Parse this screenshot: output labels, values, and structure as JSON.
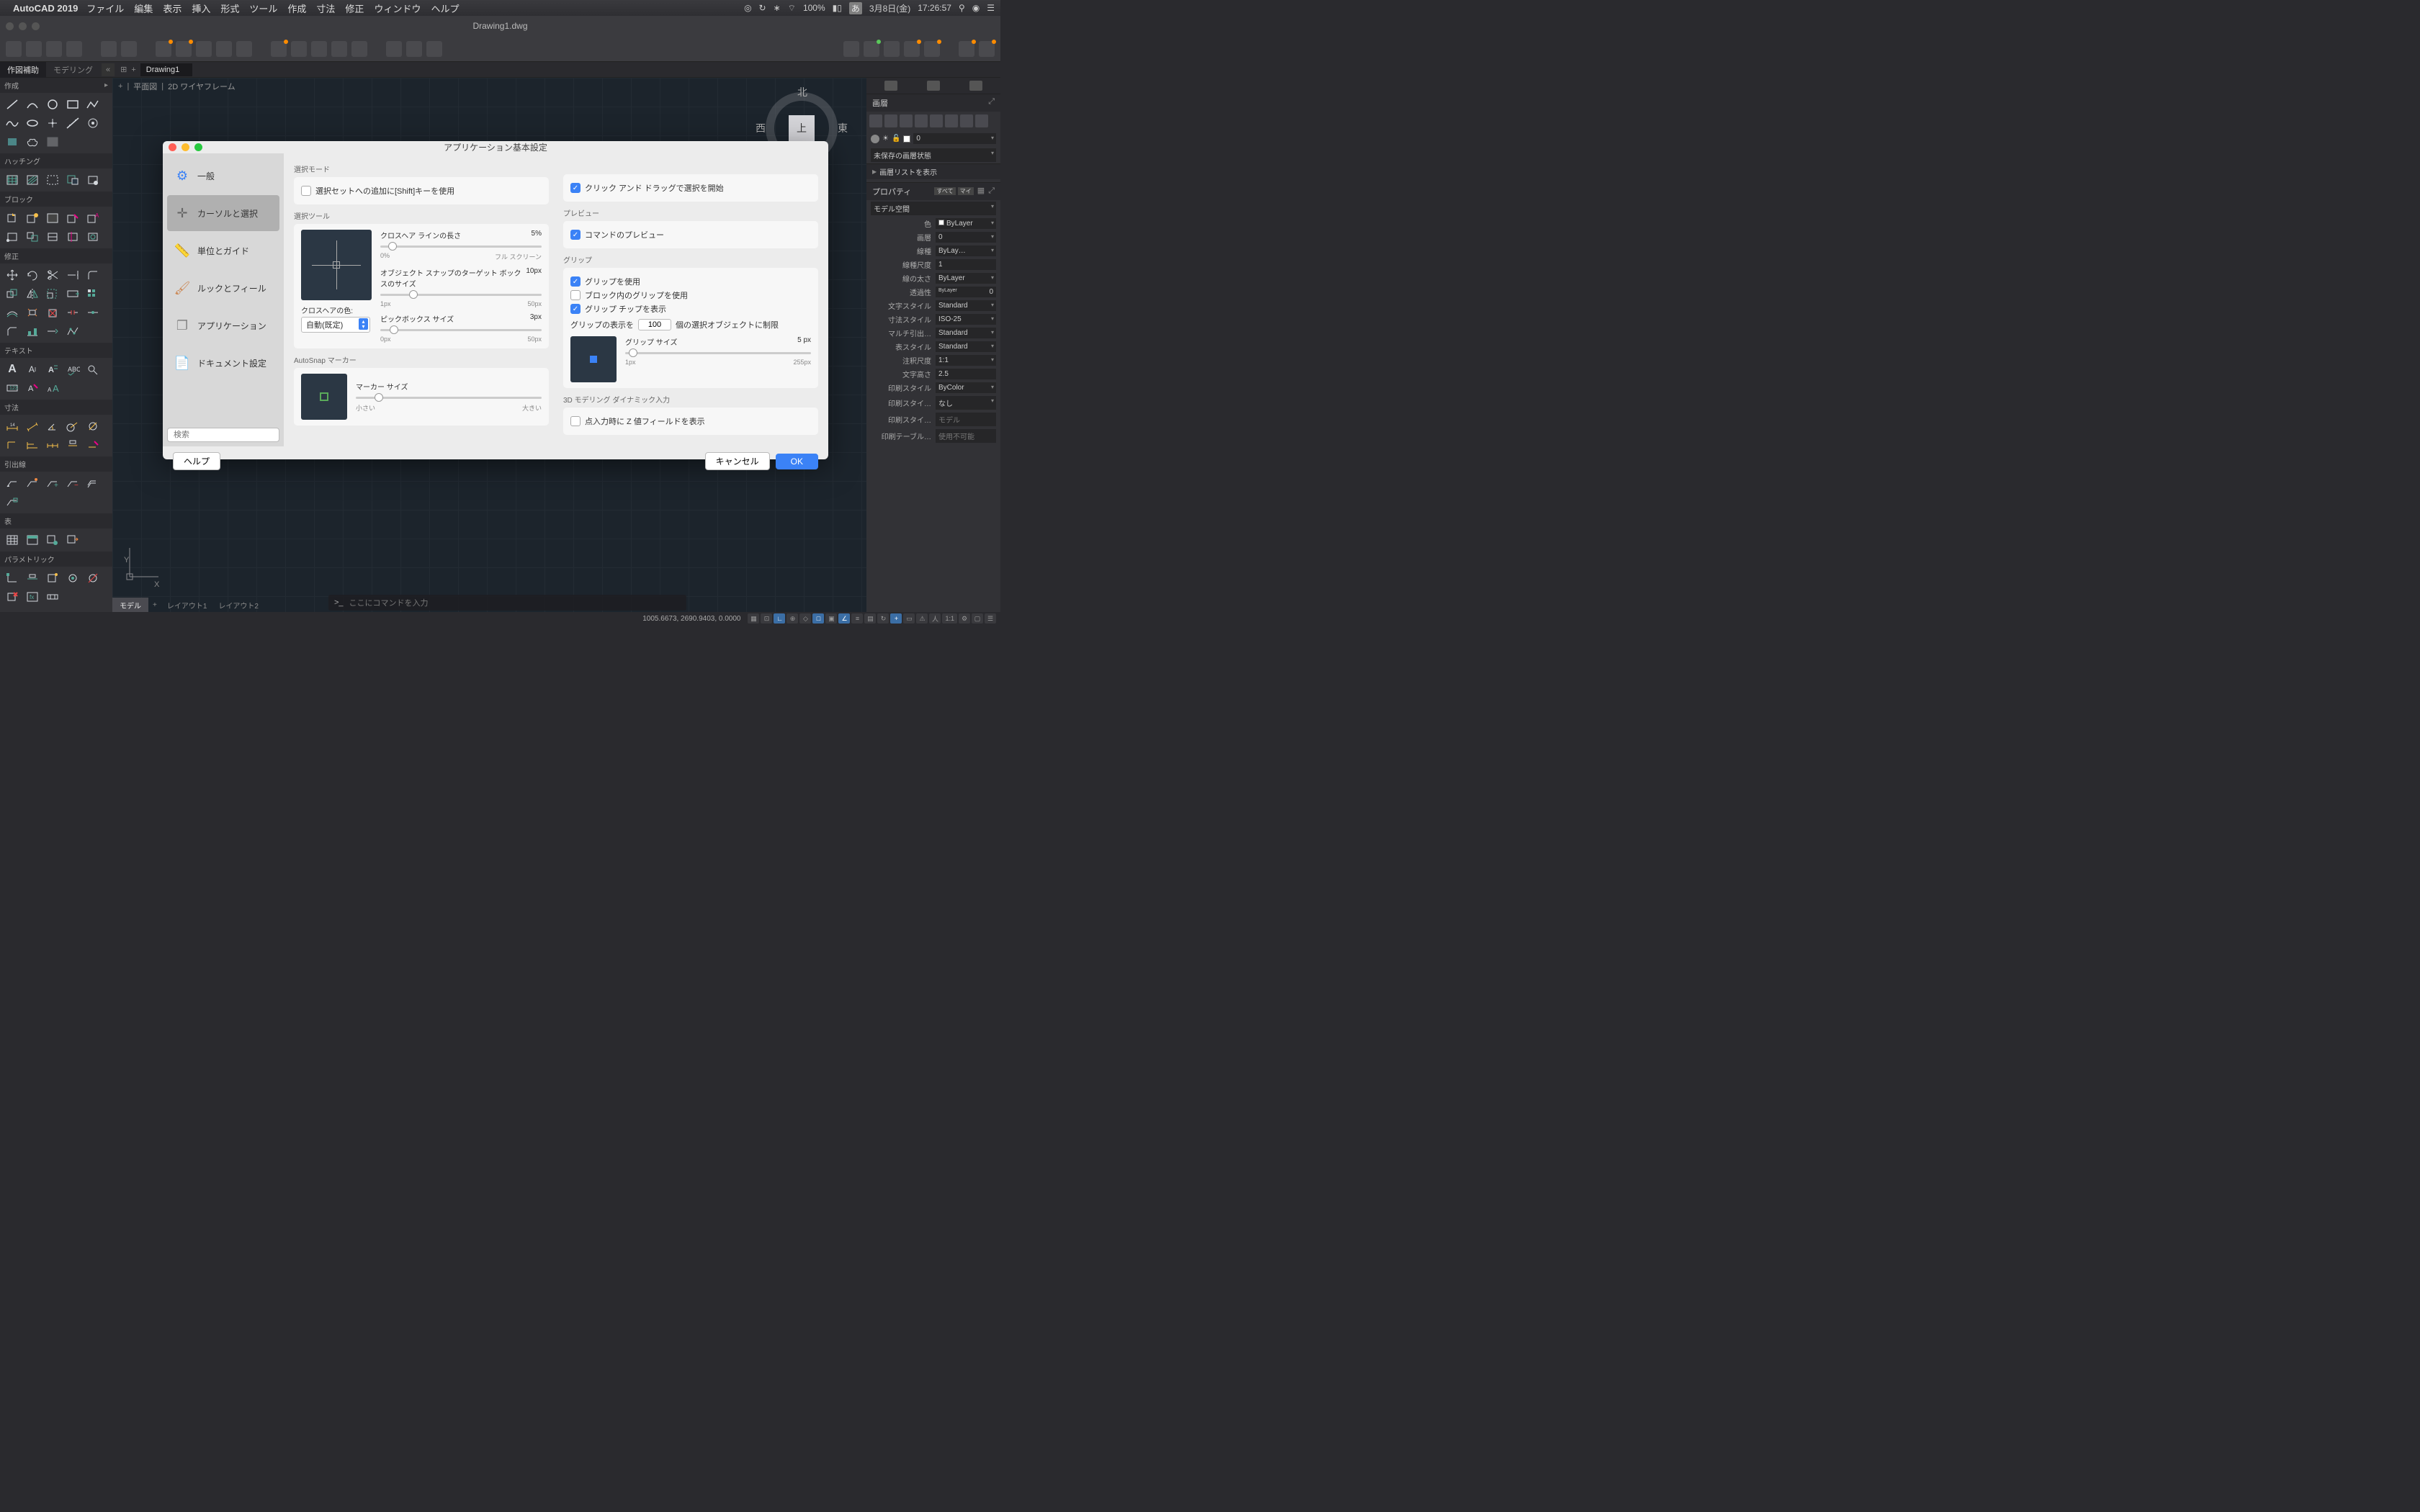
{
  "menubar": {
    "app": "AutoCAD 2019",
    "items": [
      "ファイル",
      "編集",
      "表示",
      "挿入",
      "形式",
      "ツール",
      "作成",
      "寸法",
      "修正",
      "ウィンドウ",
      "ヘルプ"
    ],
    "right": {
      "battery": "100%",
      "ime": "あ",
      "date": "3月8日(金)",
      "time": "17:26:57"
    }
  },
  "window": {
    "title": "Drawing1.dwg"
  },
  "ribbon": {
    "tab_sakuzu": "作図補助",
    "tab_modeling": "モデリング",
    "doc_name": "Drawing1"
  },
  "canvas": {
    "view_label": "平面図",
    "style_label": "2D ワイヤフレーム",
    "cube_top": "上",
    "cube_n": "北",
    "cube_e": "東",
    "cube_w": "西",
    "cmd_prompt": ">_",
    "cmd_placeholder": "ここにコマンドを入力"
  },
  "left_panels": {
    "p1": "作成",
    "p2": "ハッチング",
    "p3": "ブロック",
    "p4": "修正",
    "p5": "テキスト",
    "p6": "寸法",
    "p7": "引出線",
    "p8": "表",
    "p9": "パラメトリック"
  },
  "right_panel": {
    "title": "画層",
    "layer_val": "0",
    "save_state": "未保存の画層状態",
    "show_list": "画層リストを表示",
    "props_title": "プロパティ",
    "props_all": "すべて",
    "props_my": "マイ",
    "space": "モデル空間",
    "rows": {
      "color_l": "色",
      "color_v": "ByLayer",
      "layer_l": "画層",
      "layer_v": "0",
      "linetype_l": "線種",
      "linetype_v": "ByLay…",
      "ltscale_l": "線種尺度",
      "ltscale_v": "1",
      "lweight_l": "線の太さ",
      "lweight_v": "ByLayer",
      "trans_l": "透過性",
      "trans_v": "0",
      "tstyle_l": "文字スタイル",
      "tstyle_v": "Standard",
      "dstyle_l": "寸法スタイル",
      "dstyle_v": "ISO-25",
      "ml_l": "マルチ引出…",
      "ml_v": "Standard",
      "tbl_l": "表スタイル",
      "tbl_v": "Standard",
      "ascale_l": "注釈尺度",
      "ascale_v": "1:1",
      "theight_l": "文字高さ",
      "theight_v": "2.5",
      "pstyle_l": "印刷スタイル",
      "pstyle_v": "ByColor",
      "pstyle2_l": "印刷スタイ…",
      "pstyle2_v": "なし",
      "pstyle3_l": "印刷スタイ…",
      "pstyle3_v": "モデル",
      "ptable_l": "印刷テーブル…",
      "ptable_v": "使用不可能"
    }
  },
  "dialog": {
    "title": "アプリケーション基本設定",
    "sidebar": {
      "general": "一般",
      "cursor": "カーソルと選択",
      "units": "単位とガイド",
      "look": "ルックとフィール",
      "app": "アプリケーション",
      "doc": "ドキュメント設定"
    },
    "search_ph": "検索",
    "sec_selmode": "選択モード",
    "chk_shift": "選択セットへの追加に[Shift]キーを使用",
    "chk_clickdrag": "クリック アンド ドラッグで選択を開始",
    "sec_seltool": "選択ツール",
    "crosshair_len": "クロスヘア ラインの長さ",
    "crosshair_val": "5%",
    "ch_min": "0%",
    "ch_max": "フル スクリーン",
    "osnap_size": "オブジェクト スナップのターゲット ボックスのサイズ",
    "osnap_val": "10px",
    "os_min": "1px",
    "os_max": "50px",
    "pick_size": "ピックボックス サイズ",
    "pick_val": "3px",
    "pk_min": "0px",
    "pk_max": "50px",
    "crosshair_color": "クロスヘアの色:",
    "color_auto": "自動(既定)",
    "sec_autosnap": "AutoSnap マーカー",
    "marker_size": "マーカー サイズ",
    "ms_min": "小さい",
    "ms_max": "大きい",
    "sec_preview": "プレビュー",
    "chk_cmdpreview": "コマンドのプレビュー",
    "sec_grip": "グリップ",
    "chk_usegrip": "グリップを使用",
    "chk_blockgrip": "ブロック内のグリップを使用",
    "chk_griptip": "グリップ チップを表示",
    "grip_limit_1": "グリップの表示を",
    "grip_limit_val": "100",
    "grip_limit_2": "個の選択オブジェクトに制限",
    "grip_size": "グリップ サイズ",
    "grip_size_val": "5",
    "grip_size_unit": "px",
    "gs_min": "1px",
    "gs_max": "255px",
    "sec_3d": "3D モデリング ダイナミック入力",
    "chk_zfield": "点入力時に Z 値フィールドを表示",
    "help": "ヘルプ",
    "cancel": "キャンセル",
    "ok": "OK"
  },
  "tabs": {
    "model": "モデル",
    "layout1": "レイアウト1",
    "layout2": "レイアウト2"
  },
  "status": {
    "coords": "1005.6673, 2690.9403, 0.0000",
    "scale": "1:1"
  }
}
